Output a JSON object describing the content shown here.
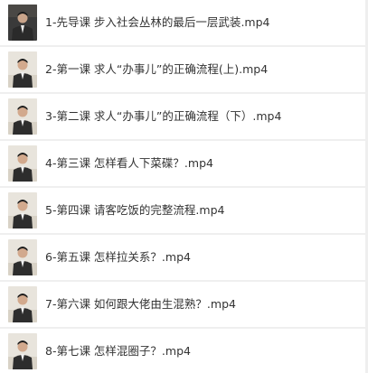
{
  "files": [
    {
      "name": "1-先导课 步入社会丛林的最后一层武装.mp4",
      "thumb": "video-thumbnail-dark"
    },
    {
      "name": "2-第一课 求人“办事儿”的正确流程(上).mp4",
      "thumb": "video-thumbnail-light"
    },
    {
      "name": "3-第二课 求人“办事儿”的正确流程（下）.mp4",
      "thumb": "video-thumbnail-light"
    },
    {
      "name": "4-第三课 怎样看人下菜碟？.mp4",
      "thumb": "video-thumbnail-light"
    },
    {
      "name": "5-第四课 请客吃饭的完整流程.mp4",
      "thumb": "video-thumbnail-light"
    },
    {
      "name": "6-第五课 怎样拉关系？.mp4",
      "thumb": "video-thumbnail-light"
    },
    {
      "name": "7-第六课 如何跟大佬由生混熟？.mp4",
      "thumb": "video-thumbnail-light"
    },
    {
      "name": "8-第七课 怎样混圈子？.mp4",
      "thumb": "video-thumbnail-light"
    }
  ],
  "colors": {
    "row_bg": "#ffffff",
    "separator": "#efefef",
    "text": "#333333",
    "thumb_dark_bg": "#3a3a3a",
    "thumb_light_bg": "#e8e4dc"
  }
}
